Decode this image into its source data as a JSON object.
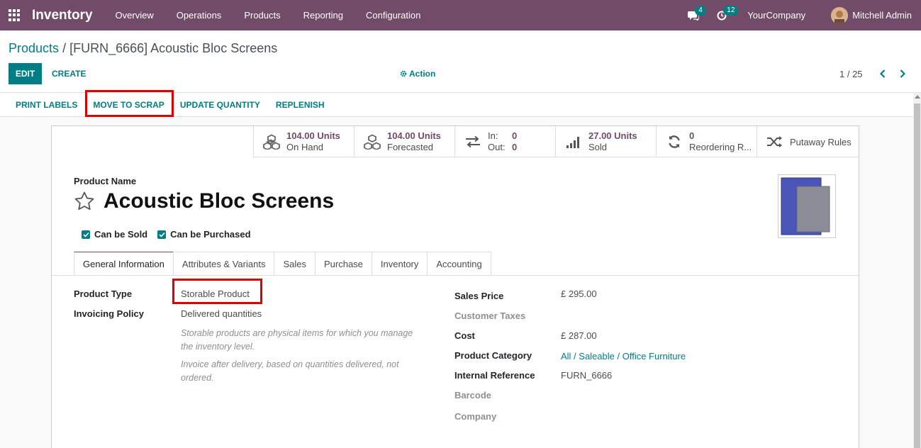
{
  "navbar": {
    "app_name": "Inventory",
    "menu": [
      "Overview",
      "Operations",
      "Products",
      "Reporting",
      "Configuration"
    ],
    "messages_count": "4",
    "activities_count": "12",
    "company": "YourCompany",
    "user": "Mitchell Admin"
  },
  "breadcrumb": {
    "parent": "Products",
    "separator": "/",
    "current": "[FURN_6666] Acoustic Bloc Screens"
  },
  "controls": {
    "edit": "EDIT",
    "create": "CREATE",
    "action": "Action",
    "pager": "1 / 25"
  },
  "statusbar": {
    "print_labels": "PRINT LABELS",
    "move_to_scrap": "MOVE TO SCRAP",
    "update_quantity": "UPDATE QUANTITY",
    "replenish": "REPLENISH"
  },
  "smart_buttons": {
    "on_hand_value": "104.00 Units",
    "on_hand_label": "On Hand",
    "forecasted_value": "104.00 Units",
    "forecasted_label": "Forecasted",
    "in_label": "In:",
    "in_value": "0",
    "out_label": "Out:",
    "out_value": "0",
    "sold_value": "27.00 Units",
    "sold_label": "Sold",
    "reordering_value": "0",
    "reordering_label": "Reordering R...",
    "putaway": "Putaway Rules"
  },
  "product": {
    "name_label": "Product Name",
    "name": "Acoustic Bloc Screens",
    "can_be_sold": "Can be Sold",
    "can_be_purchased": "Can be Purchased"
  },
  "tabs": [
    "General Information",
    "Attributes & Variants",
    "Sales",
    "Purchase",
    "Inventory",
    "Accounting"
  ],
  "general": {
    "product_type_label": "Product Type",
    "product_type": "Storable Product",
    "invoicing_policy_label": "Invoicing Policy",
    "invoicing_policy": "Delivered quantities",
    "help_1a": "Storable products are physical items for which you manage",
    "help_1b": "the inventory level.",
    "help_2a": "Invoice after delivery, based on quantities delivered, not",
    "help_2b": "ordered.",
    "sales_price_label": "Sales Price",
    "sales_price": "£ 295.00",
    "customer_taxes_label": "Customer Taxes",
    "cost_label": "Cost",
    "cost": "£ 287.00",
    "category_label": "Product Category",
    "category": "All / Saleable / Office Furniture",
    "internal_ref_label": "Internal Reference",
    "internal_ref": "FURN_6666",
    "barcode_label": "Barcode",
    "company_label": "Company"
  },
  "colors": {
    "navbar": "#714b67",
    "accent": "#017e84",
    "highlight": "#e00000"
  }
}
